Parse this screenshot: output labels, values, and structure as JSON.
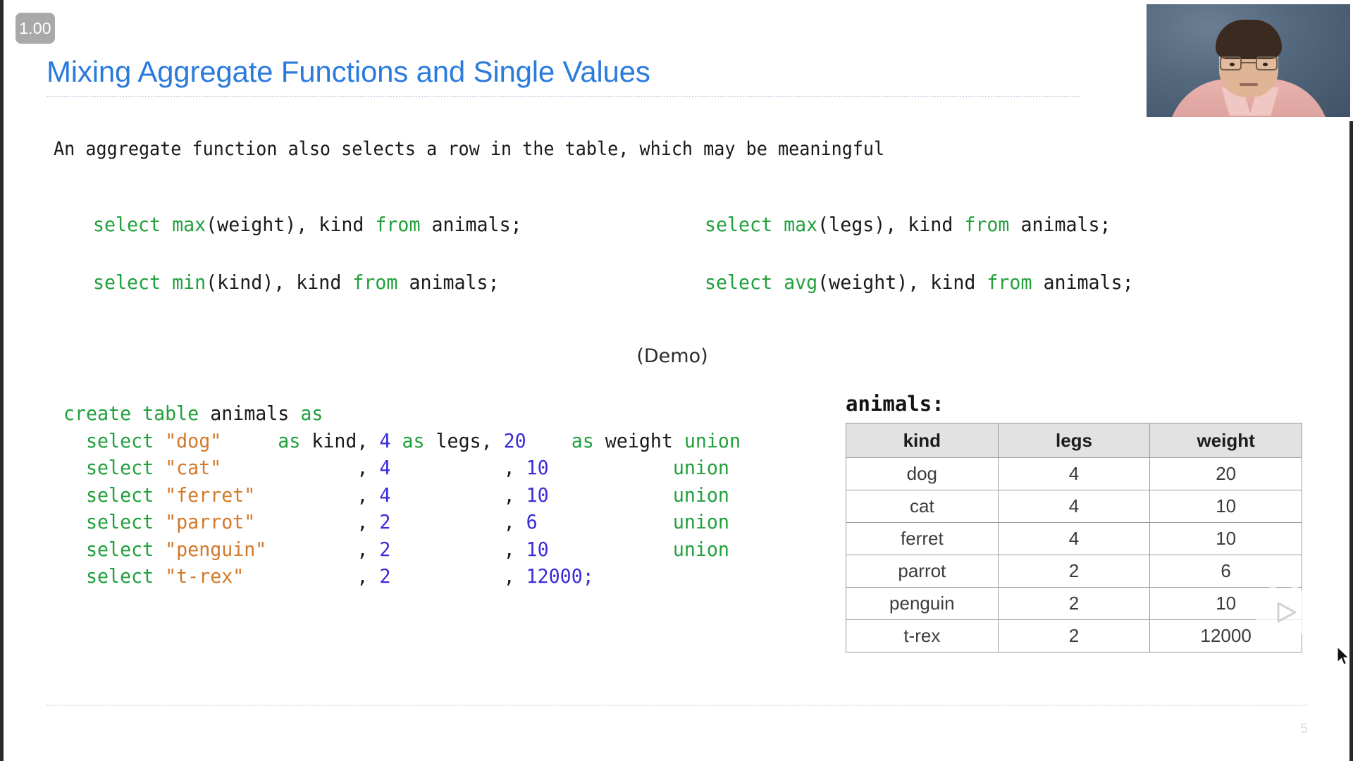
{
  "player": {
    "speed_badge": "1.00",
    "watermark_icon": "bilibili-play-icon"
  },
  "slide": {
    "title": "Mixing Aggregate Functions and Single Values",
    "lede": "An aggregate function also selects a row in the table, which may be meaningful",
    "demo_label": "(Demo)",
    "page_number": "5"
  },
  "queries": [
    {
      "id": "max-weight",
      "position": "left-row1",
      "tokens": [
        {
          "t": "select",
          "c": "kw"
        },
        {
          "t": " ",
          "c": "id"
        },
        {
          "t": "max",
          "c": "fn"
        },
        {
          "t": "(weight), kind ",
          "c": "id"
        },
        {
          "t": "from",
          "c": "kw"
        },
        {
          "t": " animals;",
          "c": "id"
        }
      ],
      "plain": "select max(weight), kind from animals;"
    },
    {
      "id": "max-legs",
      "position": "right-row1",
      "tokens": [
        {
          "t": "select",
          "c": "kw"
        },
        {
          "t": " ",
          "c": "id"
        },
        {
          "t": "max",
          "c": "fn"
        },
        {
          "t": "(legs), kind ",
          "c": "id"
        },
        {
          "t": "from",
          "c": "kw"
        },
        {
          "t": " animals;",
          "c": "id"
        }
      ],
      "plain": "select max(legs), kind from animals;"
    },
    {
      "id": "min-kind",
      "position": "left-row2",
      "tokens": [
        {
          "t": "select",
          "c": "kw"
        },
        {
          "t": " ",
          "c": "id"
        },
        {
          "t": "min",
          "c": "fn"
        },
        {
          "t": "(kind), kind ",
          "c": "id"
        },
        {
          "t": "from",
          "c": "kw"
        },
        {
          "t": " animals;",
          "c": "id"
        }
      ],
      "plain": "select min(kind), kind from animals;"
    },
    {
      "id": "avg-weight",
      "position": "right-row2",
      "tokens": [
        {
          "t": "select",
          "c": "kw"
        },
        {
          "t": " ",
          "c": "id"
        },
        {
          "t": "avg",
          "c": "fn"
        },
        {
          "t": "(weight), kind ",
          "c": "id"
        },
        {
          "t": "from",
          "c": "kw"
        },
        {
          "t": " animals;",
          "c": "id"
        }
      ],
      "plain": "select avg(weight), kind from animals;"
    }
  ],
  "create_statement": {
    "lines": [
      [
        {
          "t": "create table",
          "c": "kw"
        },
        {
          "t": " animals ",
          "c": "id"
        },
        {
          "t": "as",
          "c": "kw"
        }
      ],
      [
        {
          "t": "  ",
          "c": "id"
        },
        {
          "t": "select",
          "c": "kw"
        },
        {
          "t": " ",
          "c": "id"
        },
        {
          "t": "\"dog\"",
          "c": "str"
        },
        {
          "t": "     ",
          "c": "id"
        },
        {
          "t": "as",
          "c": "kw"
        },
        {
          "t": " kind, ",
          "c": "id"
        },
        {
          "t": "4",
          "c": "num"
        },
        {
          "t": " ",
          "c": "id"
        },
        {
          "t": "as",
          "c": "kw"
        },
        {
          "t": " legs, ",
          "c": "id"
        },
        {
          "t": "20",
          "c": "num"
        },
        {
          "t": "    ",
          "c": "id"
        },
        {
          "t": "as",
          "c": "kw"
        },
        {
          "t": " weight ",
          "c": "id"
        },
        {
          "t": "union",
          "c": "kw"
        }
      ],
      [
        {
          "t": "  ",
          "c": "id"
        },
        {
          "t": "select",
          "c": "kw"
        },
        {
          "t": " ",
          "c": "id"
        },
        {
          "t": "\"cat\"",
          "c": "str"
        },
        {
          "t": "            , ",
          "c": "id"
        },
        {
          "t": "4",
          "c": "num"
        },
        {
          "t": "          , ",
          "c": "id"
        },
        {
          "t": "10",
          "c": "num"
        },
        {
          "t": "           ",
          "c": "id"
        },
        {
          "t": "union",
          "c": "kw"
        }
      ],
      [
        {
          "t": "  ",
          "c": "id"
        },
        {
          "t": "select",
          "c": "kw"
        },
        {
          "t": " ",
          "c": "id"
        },
        {
          "t": "\"ferret\"",
          "c": "str"
        },
        {
          "t": "         , ",
          "c": "id"
        },
        {
          "t": "4",
          "c": "num"
        },
        {
          "t": "          , ",
          "c": "id"
        },
        {
          "t": "10",
          "c": "num"
        },
        {
          "t": "           ",
          "c": "id"
        },
        {
          "t": "union",
          "c": "kw"
        }
      ],
      [
        {
          "t": "  ",
          "c": "id"
        },
        {
          "t": "select",
          "c": "kw"
        },
        {
          "t": " ",
          "c": "id"
        },
        {
          "t": "\"parrot\"",
          "c": "str"
        },
        {
          "t": "         , ",
          "c": "id"
        },
        {
          "t": "2",
          "c": "num"
        },
        {
          "t": "          , ",
          "c": "id"
        },
        {
          "t": "6",
          "c": "num"
        },
        {
          "t": "            ",
          "c": "id"
        },
        {
          "t": "union",
          "c": "kw"
        }
      ],
      [
        {
          "t": "  ",
          "c": "id"
        },
        {
          "t": "select",
          "c": "kw"
        },
        {
          "t": " ",
          "c": "id"
        },
        {
          "t": "\"penguin\"",
          "c": "str"
        },
        {
          "t": "        , ",
          "c": "id"
        },
        {
          "t": "2",
          "c": "num"
        },
        {
          "t": "          , ",
          "c": "id"
        },
        {
          "t": "10",
          "c": "num"
        },
        {
          "t": "           ",
          "c": "id"
        },
        {
          "t": "union",
          "c": "kw"
        }
      ],
      [
        {
          "t": "  ",
          "c": "id"
        },
        {
          "t": "select",
          "c": "kw"
        },
        {
          "t": " ",
          "c": "id"
        },
        {
          "t": "\"t-rex\"",
          "c": "str"
        },
        {
          "t": "          , ",
          "c": "id"
        },
        {
          "t": "2",
          "c": "num"
        },
        {
          "t": "          , ",
          "c": "id"
        },
        {
          "t": "12000;",
          "c": "num"
        }
      ]
    ]
  },
  "animals_table": {
    "caption": "animals:",
    "columns": [
      "kind",
      "legs",
      "weight"
    ],
    "rows": [
      [
        "dog",
        "4",
        "20"
      ],
      [
        "cat",
        "4",
        "10"
      ],
      [
        "ferret",
        "4",
        "10"
      ],
      [
        "parrot",
        "2",
        "6"
      ],
      [
        "penguin",
        "2",
        "10"
      ],
      [
        "t-rex",
        "2",
        "12000"
      ]
    ]
  },
  "colors": {
    "title": "#2b7bdd",
    "keyword": "#22a03c",
    "string": "#d2792a",
    "number": "#3a2ad8",
    "identifier": "#1a1a1a",
    "table_header_bg": "#e2e2e2",
    "badge_bg": "#a9a9a9"
  }
}
